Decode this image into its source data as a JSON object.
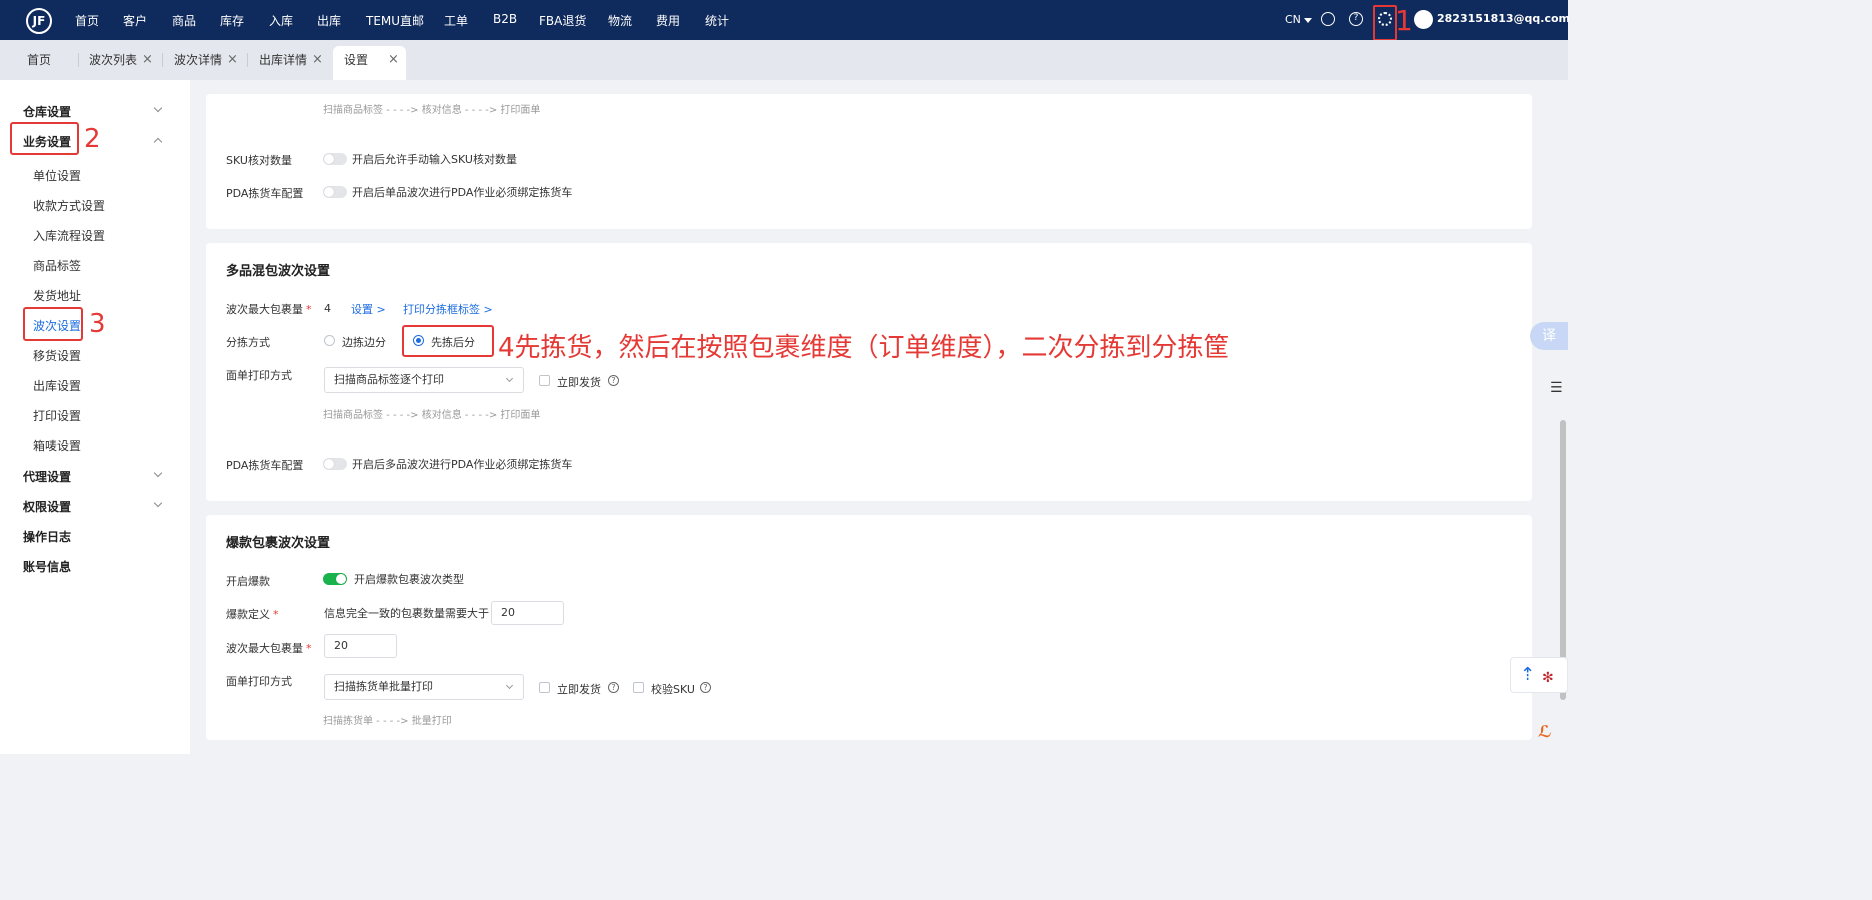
{
  "topbar": {
    "logo": "JF",
    "nav": [
      "首页",
      "客户",
      "商品",
      "库存",
      "入库",
      "出库",
      "TEMU直邮",
      "工单",
      "B2B",
      "FBA退货",
      "物流",
      "费用",
      "统计"
    ],
    "lang": "CN",
    "history_icon": "clock-icon",
    "help_icon": "?",
    "settings_icon": "gear-icon",
    "user": "2823151813@qq.com"
  },
  "tabs": [
    {
      "label": "首页",
      "closable": false
    },
    {
      "label": "波次列表",
      "closable": true
    },
    {
      "label": "波次详情",
      "closable": true
    },
    {
      "label": "出库详情",
      "closable": true
    },
    {
      "label": "设置",
      "closable": true,
      "active": true
    }
  ],
  "sidebar": {
    "groups": [
      {
        "label": "仓库设置",
        "chevron": "down"
      },
      {
        "label": "业务设置",
        "chevron": "up"
      },
      {
        "label": "代理设置",
        "chevron": "down"
      },
      {
        "label": "权限设置",
        "chevron": "down"
      },
      {
        "label": "操作日志"
      },
      {
        "label": "账号信息"
      }
    ],
    "business_items": [
      "单位设置",
      "收款方式设置",
      "入库流程设置",
      "商品标签",
      "发货地址",
      "波次设置",
      "移货设置",
      "出库设置",
      "打印设置",
      "箱唛设置"
    ],
    "selected": "波次设置"
  },
  "annotations": {
    "a1": "1",
    "a2": "2",
    "a3": "3",
    "a4": "4先拣货，然后在按照包裹维度（订单维度），二次分拣到分拣筐"
  },
  "single_card": {
    "flow": "扫描商品标签 - - - -> 核对信息 - - - -> 打印面单",
    "sku_label": "SKU核对数量",
    "sku_toggle_text": "开启后允许手动输入SKU核对数量",
    "sku_toggle_on": false,
    "pda_label": "PDA拣货车配置",
    "pda_toggle_text": "开启后单品波次进行PDA作业必须绑定拣货车",
    "pda_toggle_on": false
  },
  "multi_card": {
    "title": "多品混包波次设置",
    "max_label": "波次最大包裹量",
    "max_value": "4",
    "set_link": "设置 >",
    "print_link": "打印分拣框标签 >",
    "sort_label": "分拣方式",
    "sort_options": [
      "边拣边分",
      "先拣后分"
    ],
    "sort_selected": "先拣后分",
    "print_label": "面单打印方式",
    "print_select": "扫描商品标签逐个打印",
    "ship_now": "立即发货",
    "flow": "扫描商品标签 - - - -> 核对信息 - - - -> 打印面单",
    "pda_label": "PDA拣货车配置",
    "pda_toggle_text": "开启后多品波次进行PDA作业必须绑定拣货车",
    "pda_toggle_on": false
  },
  "hot_card": {
    "title": "爆款包裹波次设置",
    "enable_label": "开启爆款",
    "enable_text": "开启爆款包裹波次类型",
    "enable_on": true,
    "def_label": "爆款定义",
    "def_text": "信息完全一致的包裹数量需要大于",
    "def_value": "20",
    "max_label": "波次最大包裹量",
    "max_value": "20",
    "print_label": "面单打印方式",
    "print_select": "扫描拣货单批量打印",
    "ship_now": "立即发货",
    "verify_sku": "校验SKU",
    "flow": "扫描拣货单 - - - -> 批量打印"
  },
  "floating": {
    "translate": "译",
    "scroll_top": "top-arrow-icon"
  },
  "colors": {
    "topbar": "#0f2a5c",
    "accent": "#1c6ce0",
    "annotation": "#e53935",
    "toggle_on": "#18b34b"
  }
}
